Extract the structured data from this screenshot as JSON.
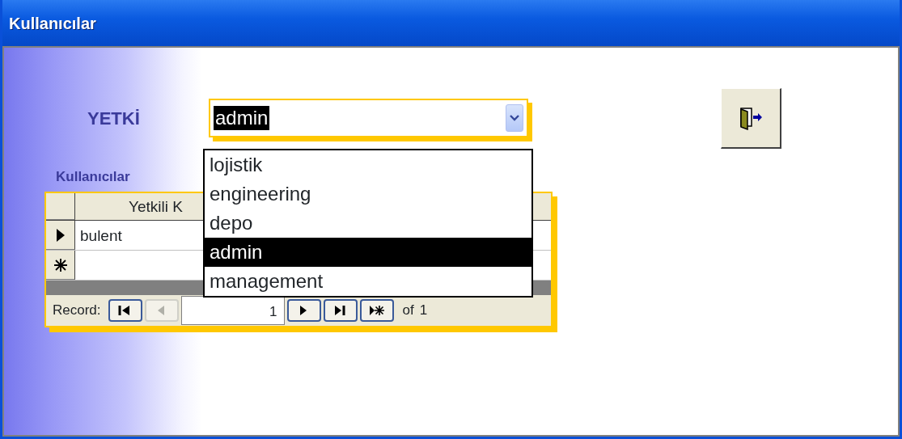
{
  "window": {
    "title": "Kullanıcılar"
  },
  "yetki": {
    "label": "YETKİ",
    "value": "admin",
    "expanded": true,
    "options": [
      {
        "label": "lojistik",
        "selected": false
      },
      {
        "label": "engineering",
        "selected": false
      },
      {
        "label": "depo",
        "selected": false
      },
      {
        "label": "admin",
        "selected": true
      },
      {
        "label": "management",
        "selected": false
      }
    ]
  },
  "subform": {
    "label": "Kullanıcılar",
    "columns": [
      "Yetkili K"
    ],
    "rows": [
      {
        "cells": [
          "bulent"
        ],
        "current": true
      }
    ],
    "navigation": {
      "label": "Record:",
      "current": "1",
      "of": "of",
      "total": "1",
      "buttons": [
        {
          "kind": "first",
          "disabled": false
        },
        {
          "kind": "prev",
          "disabled": true
        },
        {
          "kind": "next",
          "disabled": false
        },
        {
          "kind": "last",
          "disabled": false
        },
        {
          "kind": "new",
          "disabled": false
        }
      ]
    }
  }
}
